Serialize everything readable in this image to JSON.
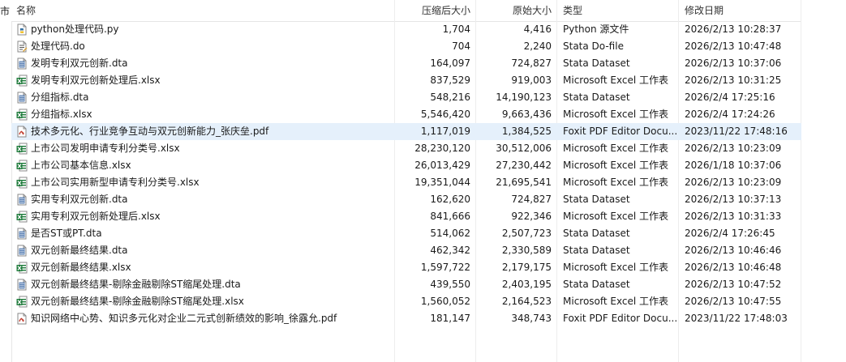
{
  "left_edge_glyph": "市",
  "columns": {
    "name": "名称",
    "compressed": "压缩后大小",
    "original": "原始大小",
    "type": "类型",
    "modified": "修改日期"
  },
  "colors": {
    "selected_row": "#e5f0fb",
    "excel_green": "#1d7a3a",
    "pdf_red": "#c0392b",
    "stata_blue": "#2f5f9e"
  },
  "files": [
    {
      "name": "python处理代码.py",
      "compressed": "1,704",
      "original": "4,416",
      "type": "Python 源文件",
      "modified": "2026/2/13 10:28:37",
      "icon": "python-file-icon",
      "selected": false
    },
    {
      "name": "处理代码.do",
      "compressed": "704",
      "original": "2,240",
      "type": "Stata Do-file",
      "modified": "2026/2/13 10:47:48",
      "icon": "do-file-icon",
      "selected": false
    },
    {
      "name": "发明专利双元创新.dta",
      "compressed": "164,097",
      "original": "724,827",
      "type": "Stata Dataset",
      "modified": "2026/2/13 10:37:06",
      "icon": "dta-file-icon",
      "selected": false
    },
    {
      "name": "发明专利双元创新处理后.xlsx",
      "compressed": "837,529",
      "original": "919,003",
      "type": "Microsoft Excel 工作表",
      "modified": "2026/2/13 10:31:25",
      "icon": "excel-file-icon",
      "selected": false
    },
    {
      "name": "分组指标.dta",
      "compressed": "548,216",
      "original": "14,190,123",
      "type": "Stata Dataset",
      "modified": "2026/2/4 17:25:16",
      "icon": "dta-file-icon",
      "selected": false
    },
    {
      "name": "分组指标.xlsx",
      "compressed": "5,546,420",
      "original": "9,663,436",
      "type": "Microsoft Excel 工作表",
      "modified": "2026/2/4 17:24:26",
      "icon": "excel-file-icon",
      "selected": false
    },
    {
      "name": "技术多元化、行业竞争互动与双元创新能力_张庆垒.pdf",
      "compressed": "1,117,019",
      "original": "1,384,525",
      "type": "Foxit PDF Editor Docu...",
      "modified": "2023/11/22 17:48:16",
      "icon": "pdf-file-icon",
      "selected": true
    },
    {
      "name": "上市公司发明申请专利分类号.xlsx",
      "compressed": "28,230,120",
      "original": "30,512,006",
      "type": "Microsoft Excel 工作表",
      "modified": "2026/2/13 10:23:09",
      "icon": "excel-file-icon",
      "selected": false
    },
    {
      "name": "上市公司基本信息.xlsx",
      "compressed": "26,013,429",
      "original": "27,230,442",
      "type": "Microsoft Excel 工作表",
      "modified": "2026/1/18 10:37:06",
      "icon": "excel-file-icon",
      "selected": false
    },
    {
      "name": "上市公司实用新型申请专利分类号.xlsx",
      "compressed": "19,351,044",
      "original": "21,695,541",
      "type": "Microsoft Excel 工作表",
      "modified": "2026/2/13 10:23:09",
      "icon": "excel-file-icon",
      "selected": false
    },
    {
      "name": "实用专利双元创新.dta",
      "compressed": "162,620",
      "original": "724,827",
      "type": "Stata Dataset",
      "modified": "2026/2/13 10:37:13",
      "icon": "dta-file-icon",
      "selected": false
    },
    {
      "name": "实用专利双元创新处理后.xlsx",
      "compressed": "841,666",
      "original": "922,346",
      "type": "Microsoft Excel 工作表",
      "modified": "2026/2/13 10:31:33",
      "icon": "excel-file-icon",
      "selected": false
    },
    {
      "name": "是否ST或PT.dta",
      "compressed": "514,062",
      "original": "2,507,723",
      "type": "Stata Dataset",
      "modified": "2026/2/4 17:26:45",
      "icon": "dta-file-icon",
      "selected": false
    },
    {
      "name": "双元创新最终结果.dta",
      "compressed": "462,342",
      "original": "2,330,589",
      "type": "Stata Dataset",
      "modified": "2026/2/13 10:46:46",
      "icon": "dta-file-icon",
      "selected": false
    },
    {
      "name": "双元创新最终结果.xlsx",
      "compressed": "1,597,722",
      "original": "2,179,175",
      "type": "Microsoft Excel 工作表",
      "modified": "2026/2/13 10:46:48",
      "icon": "excel-file-icon",
      "selected": false
    },
    {
      "name": "双元创新最终结果-剔除金融剔除ST缩尾处理.dta",
      "compressed": "439,550",
      "original": "2,403,195",
      "type": "Stata Dataset",
      "modified": "2026/2/13 10:47:52",
      "icon": "dta-file-icon",
      "selected": false
    },
    {
      "name": "双元创新最终结果-剔除金融剔除ST缩尾处理.xlsx",
      "compressed": "1,560,052",
      "original": "2,164,523",
      "type": "Microsoft Excel 工作表",
      "modified": "2026/2/13 10:47:55",
      "icon": "excel-file-icon",
      "selected": false
    },
    {
      "name": "知识网络中心势、知识多元化对企业二元式创新绩效的影响_徐露允.pdf",
      "compressed": "181,147",
      "original": "348,743",
      "type": "Foxit PDF Editor Docu...",
      "modified": "2023/11/22 17:48:03",
      "icon": "pdf-file-icon",
      "selected": false
    }
  ]
}
